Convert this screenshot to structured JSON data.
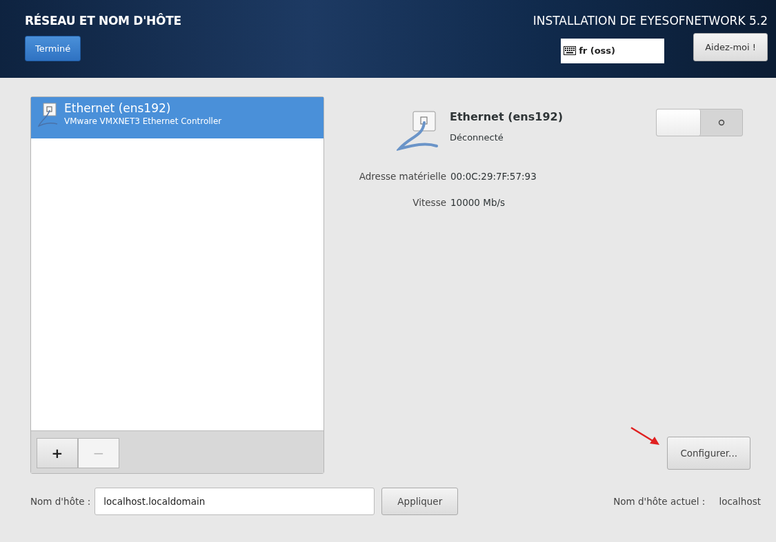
{
  "header": {
    "title": "RÉSEAU ET NOM D'HÔTE",
    "done_button": "Terminé",
    "product": "INSTALLATION DE EYESOFNETWORK 5.2",
    "keyboard": "fr (oss)",
    "help_button": "Aidez-moi !"
  },
  "devices": [
    {
      "name": "Ethernet (ens192)",
      "description": "VMware VMXNET3 Ethernet Controller",
      "selected": true
    }
  ],
  "list_buttons": [
    {
      "label": "+",
      "disabled": false
    },
    {
      "label": "−",
      "disabled": true
    }
  ],
  "detail": {
    "name": "Ethernet (ens192)",
    "status": "Déconnecté",
    "on": false,
    "properties": [
      {
        "label": "Adresse matérielle",
        "value": "00:0C:29:7F:57:93"
      },
      {
        "label": "Vitesse",
        "value": "10000 Mb/s"
      }
    ],
    "configure_button": "Configurer..."
  },
  "hostname": {
    "label": "Nom d'hôte :",
    "value": "localhost.localdomain",
    "apply_button": "Appliquer",
    "current_label": "Nom d'hôte actuel :",
    "current_value": "localhost"
  }
}
